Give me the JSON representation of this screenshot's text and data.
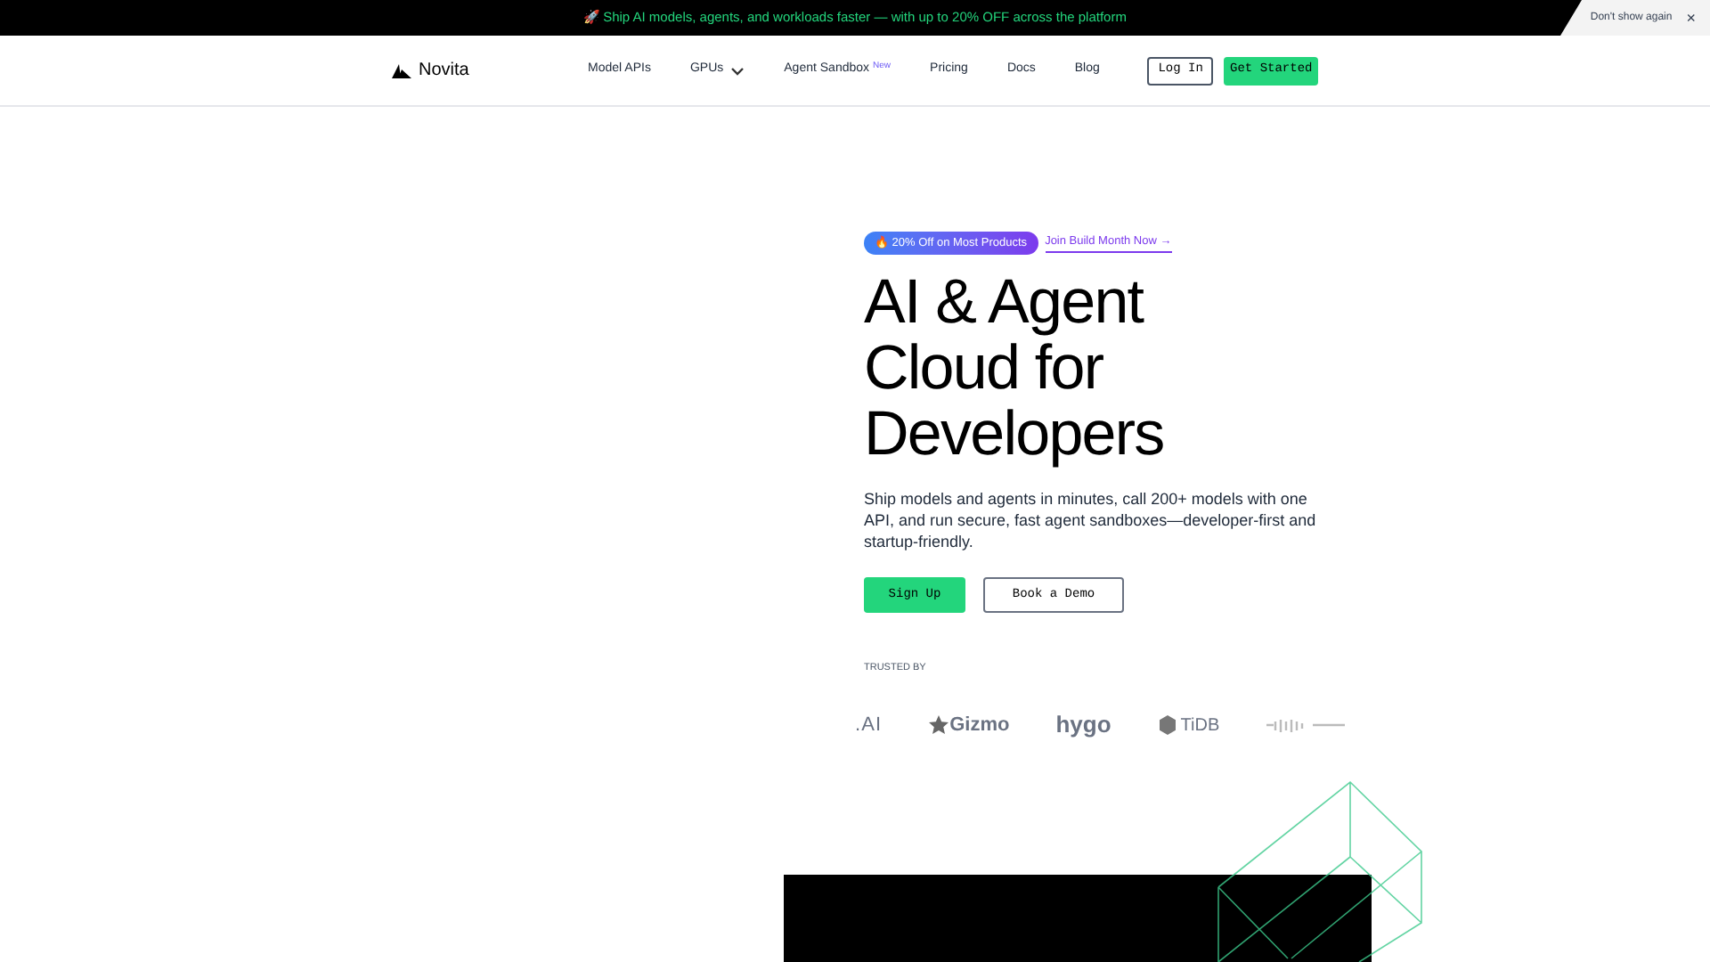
{
  "banner": {
    "icon": "🚀",
    "text": "Ship AI models, agents, and workloads faster — with up to 20% OFF across the platform",
    "dismiss": "Don't show again",
    "close": "×"
  },
  "nav": {
    "logo": "Novita",
    "items": [
      {
        "label": "Model APIs",
        "kind": "link"
      },
      {
        "label": "GPUs",
        "kind": "dropdown"
      },
      {
        "label": "Agent Sandbox",
        "kind": "badge",
        "badge": "New"
      },
      {
        "label": "Pricing",
        "kind": "link"
      },
      {
        "label": "Docs",
        "kind": "link"
      },
      {
        "label": "Blog",
        "kind": "link"
      }
    ],
    "login": "Log In",
    "cta": "Get Started"
  },
  "hero": {
    "promo": {
      "icon": "🔥",
      "text": "20% Off on Most Products"
    },
    "promo_link": "Join Build Month Now →",
    "title": [
      "AI & Agent",
      "Cloud for",
      "Developers"
    ],
    "subtitle": "Ship models and agents in minutes, call 200+ models with one API, and run secure, fast agent sandboxes—developer-first and startup-friendly.",
    "primary": "Sign Up",
    "secondary": "Book a Demo"
  },
  "trusted": {
    "label": "TRUSTED BY",
    "logos": [
      {
        "kind": "text",
        "text": ".AI"
      },
      {
        "kind": "star",
        "text": "Gizmo"
      },
      {
        "kind": "bold",
        "text": "hygo"
      },
      {
        "kind": "hex",
        "text": "TiDB"
      },
      {
        "kind": "graphic"
      }
    ]
  }
}
